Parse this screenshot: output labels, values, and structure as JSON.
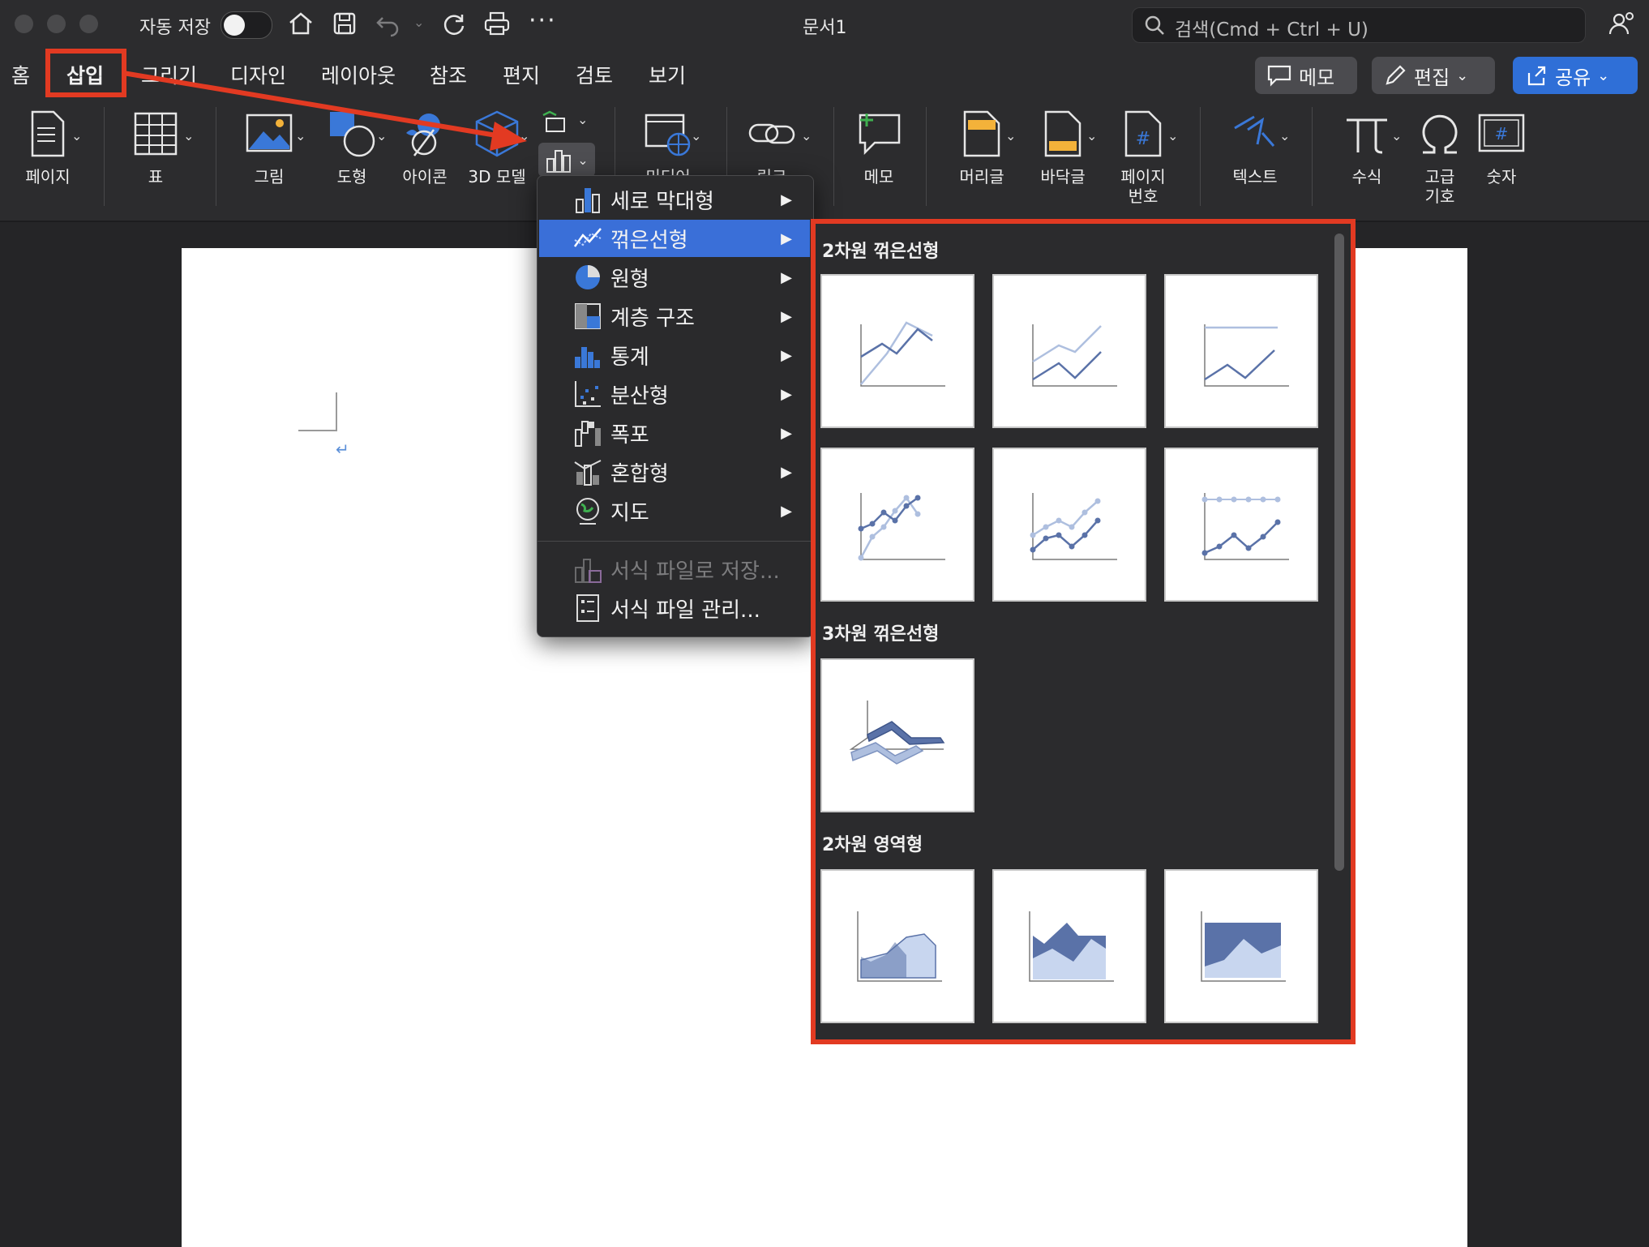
{
  "titlebar": {
    "autosave_label": "자동 저장",
    "doc_title": "문서1",
    "search_placeholder": "검색(Cmd + Ctrl + U)"
  },
  "tabs": [
    {
      "label": "홈"
    },
    {
      "label": "삽입",
      "active": true
    },
    {
      "label": "그리기"
    },
    {
      "label": "디자인"
    },
    {
      "label": "레이아웃"
    },
    {
      "label": "참조"
    },
    {
      "label": "편지"
    },
    {
      "label": "검토"
    },
    {
      "label": "보기"
    }
  ],
  "actions": {
    "memo": "메모",
    "edit": "편집",
    "share": "공유"
  },
  "ribbon": {
    "page": "페이지",
    "table": "표",
    "picture": "그림",
    "shapes": "도형",
    "icons": "아이콘",
    "model3d": "3D 모델",
    "media": "미디어",
    "link": "링크",
    "comment": "메모",
    "header": "머리글",
    "footer": "바닥글",
    "page_number_1": "페이지",
    "page_number_2": "번호",
    "text": "텍스트",
    "equation": "수식",
    "symbol_1": "고급",
    "symbol_2": "기호",
    "number": "숫자"
  },
  "chart_menu": {
    "items": [
      {
        "label": "세로 막대형",
        "icon": "column-chart-icon"
      },
      {
        "label": "꺾은선형",
        "icon": "line-chart-icon",
        "highlighted": true
      },
      {
        "label": "원형",
        "icon": "pie-chart-icon"
      },
      {
        "label": "계층 구조",
        "icon": "hierarchy-chart-icon"
      },
      {
        "label": "통계",
        "icon": "statistic-chart-icon"
      },
      {
        "label": "분산형",
        "icon": "scatter-chart-icon"
      },
      {
        "label": "폭포",
        "icon": "waterfall-chart-icon"
      },
      {
        "label": "혼합형",
        "icon": "combo-chart-icon"
      },
      {
        "label": "지도",
        "icon": "map-chart-icon"
      }
    ],
    "save_template": "서식 파일로 저장...",
    "manage_templates": "서식 파일 관리..."
  },
  "gallery": {
    "sections": [
      {
        "title": "2차원 꺾은선형"
      },
      {
        "title": "3차원 꺾은선형"
      },
      {
        "title": "2차원 영역형"
      }
    ]
  },
  "colors": {
    "highlight": "#3a6fd8",
    "annotation": "#e23a22",
    "share_button": "#2f6fd7",
    "chart_dark": "#5a72a8",
    "chart_light": "#aebfdf"
  }
}
